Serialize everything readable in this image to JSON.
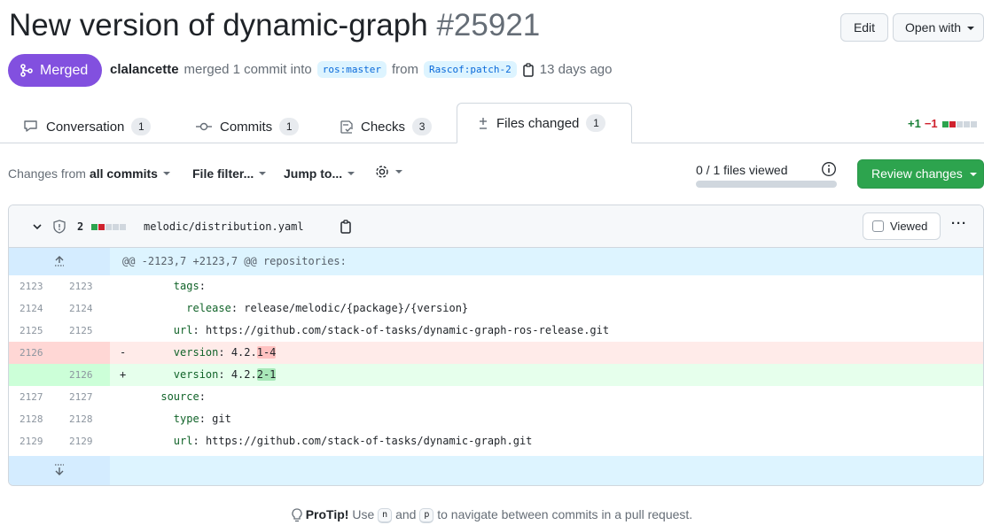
{
  "pr": {
    "title": "New version of dynamic-graph",
    "number": "#25921",
    "edit_label": "Edit",
    "open_with_label": "Open with",
    "status": "Merged",
    "author": "clalancette",
    "action_text": "merged 1 commit into",
    "base_branch": "ros:master",
    "from_text": "from",
    "head_branch": "Rascof:patch-2",
    "time_ago": "13 days ago"
  },
  "tabs": [
    {
      "label": "Conversation",
      "count": "1",
      "icon": "comment-icon"
    },
    {
      "label": "Commits",
      "count": "1",
      "icon": "commit-icon"
    },
    {
      "label": "Checks",
      "count": "3",
      "icon": "checklist-icon"
    },
    {
      "label": "Files changed",
      "count": "1",
      "icon": "file-diff-icon",
      "active": true
    }
  ],
  "diffstat": {
    "additions": "+1",
    "deletions": "−1"
  },
  "toolbar": {
    "changes_from_prefix": "Changes from",
    "changes_from_value": "all commits",
    "file_filter": "File filter...",
    "jump_to": "Jump to...",
    "files_viewed": "0 / 1 files viewed",
    "files_viewed_fraction": 0,
    "review_changes": "Review changes"
  },
  "file": {
    "change_count": "2",
    "path": "melodic/distribution.yaml",
    "viewed_label": "Viewed",
    "more_label": "···"
  },
  "hunk_header": "@@ -2123,7 +2123,7 @@ repositories:",
  "lines": [
    {
      "old": "2123",
      "new": "2123",
      "type": "ctx",
      "indent": "        ",
      "key": "tags",
      "value": ""
    },
    {
      "old": "2124",
      "new": "2124",
      "type": "ctx",
      "indent": "          ",
      "key": "release",
      "value": "release/melodic/{package}/{version}"
    },
    {
      "old": "2125",
      "new": "2125",
      "type": "ctx",
      "indent": "        ",
      "key": "url",
      "value": "https://github.com/stack-of-tasks/dynamic-graph-ros-release.git"
    },
    {
      "old": "2126",
      "new": "",
      "type": "del",
      "indent": "        ",
      "key": "version",
      "value_pre": "4.2.",
      "value_hl": "1-4"
    },
    {
      "old": "",
      "new": "2126",
      "type": "add",
      "indent": "        ",
      "key": "version",
      "value_pre": "4.2.",
      "value_hl": "2-1"
    },
    {
      "old": "2127",
      "new": "2127",
      "type": "ctx",
      "indent": "      ",
      "key": "source",
      "value": ""
    },
    {
      "old": "2128",
      "new": "2128",
      "type": "ctx",
      "indent": "        ",
      "key": "type",
      "value": "git"
    },
    {
      "old": "2129",
      "new": "2129",
      "type": "ctx",
      "indent": "        ",
      "key": "url",
      "value": "https://github.com/stack-of-tasks/dynamic-graph.git"
    }
  ],
  "protip": {
    "label": "ProTip!",
    "text_1": "Use",
    "key_1": "n",
    "text_2": "and",
    "key_2": "p",
    "text_3": "to navigate between commits in a pull request."
  },
  "colors": {
    "merged": "#8250df",
    "add_bg": "#dafbe1",
    "del_bg": "#ffebe9",
    "primary_button": "#2da44e",
    "link": "#0969da"
  }
}
